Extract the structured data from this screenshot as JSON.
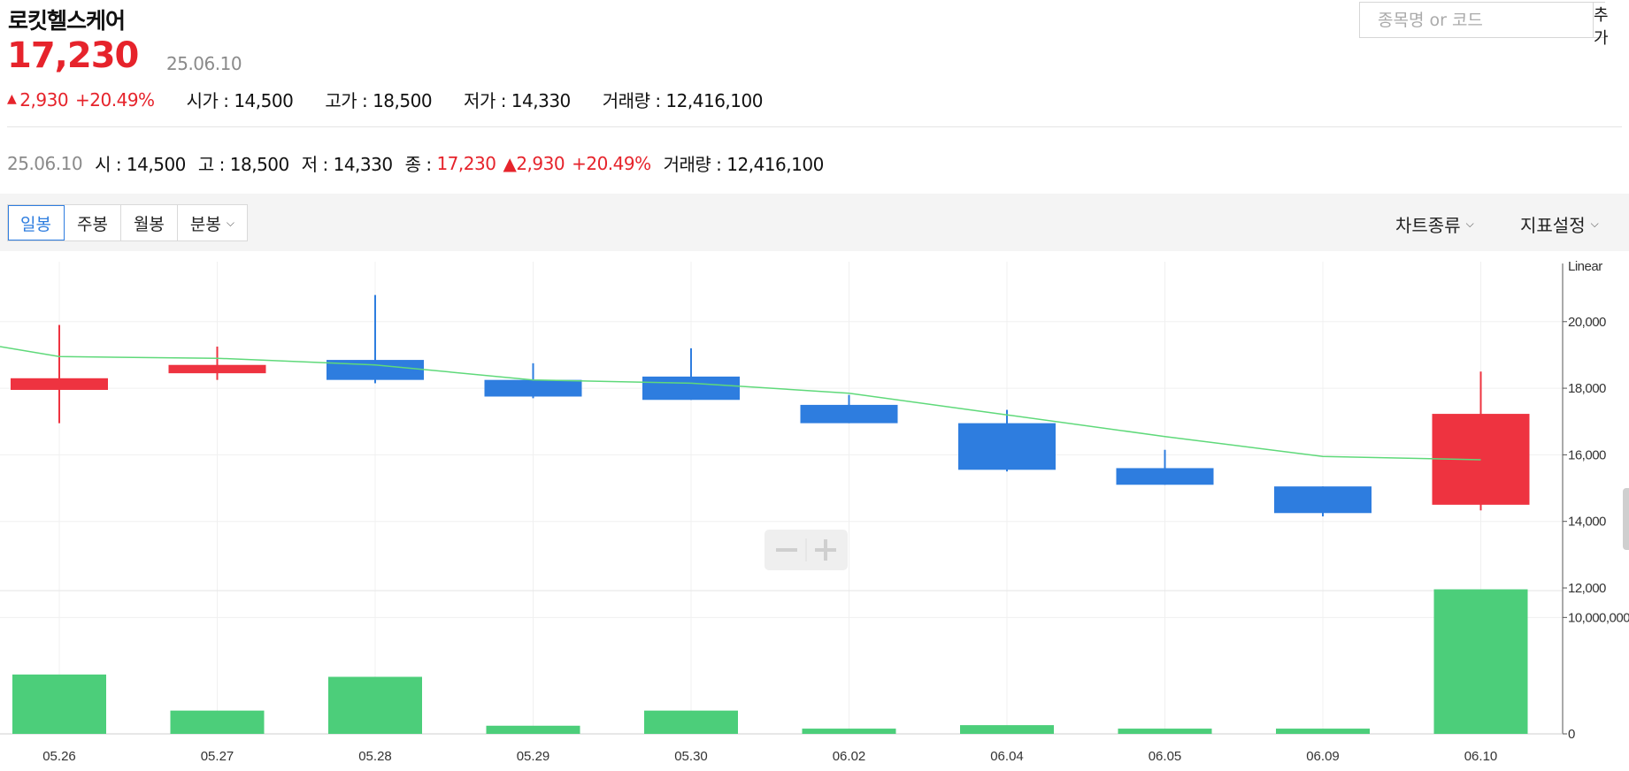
{
  "header": {
    "stock_name": "로킷헬스케어",
    "price": "17,230",
    "date": "25.06.10"
  },
  "summary": {
    "change": "2,930",
    "change_pct": "+20.49%",
    "open": "시가 : 14,500",
    "high": "고가 : 18,500",
    "low": "저가 : 14,330",
    "volume": "거래량 : 12,416,100"
  },
  "ohlc_bar": {
    "date": "25.06.10",
    "open": "시 : 14,500",
    "high": "고 : 18,500",
    "low": "저 : 14,330",
    "close_label": "종 : ",
    "close_value": "17,230",
    "change": "2,930",
    "change_pct": "+20.49%",
    "volume": "거래량 : 12,416,100"
  },
  "search": {
    "placeholder": "종목명 or 코드",
    "add_label": "추가"
  },
  "toolbar": {
    "tabs": [
      "일봉",
      "주봉",
      "월봉",
      "분봉"
    ],
    "chart_type_label": "차트종류",
    "indicator_label": "지표설정"
  },
  "colors": {
    "up": "#ee3340",
    "down": "#2e7ddf",
    "volume": "#4cce7a",
    "ma": "#5fd97a",
    "accent_red": "#e6232b"
  },
  "chart_data": {
    "type": "candlestick",
    "scale_label": "Linear",
    "categories": [
      "05.26",
      "05.27",
      "05.28",
      "05.29",
      "05.30",
      "06.02",
      "06.04",
      "06.05",
      "06.09",
      "06.10"
    ],
    "open": [
      17950,
      18450,
      18850,
      18250,
      18350,
      17500,
      16950,
      15600,
      15050,
      14500
    ],
    "high": [
      19900,
      19250,
      20800,
      18750,
      19200,
      17800,
      17350,
      16150,
      15050,
      18500
    ],
    "low": [
      16950,
      18250,
      18150,
      17700,
      17650,
      16950,
      15500,
      15100,
      14150,
      14330
    ],
    "close": [
      18300,
      18700,
      18250,
      17750,
      17650,
      16950,
      15550,
      15100,
      14250,
      17230
    ],
    "moving_average": [
      18950,
      18900,
      18700,
      18250,
      18150,
      17850,
      17200,
      16550,
      15950,
      15850
    ],
    "volume": [
      5100000,
      2000000,
      4900000,
      700000,
      2000000,
      450000,
      750000,
      450000,
      450000,
      12416100
    ],
    "price_ylim": [
      12000,
      21800
    ],
    "price_ticks": [
      "20,000",
      "18,000",
      "16,000",
      "14,000",
      "12,000"
    ],
    "volume_ylim": [
      0,
      12000000
    ],
    "volume_ticks": [
      "10,000,000",
      "0"
    ],
    "grid": true
  }
}
